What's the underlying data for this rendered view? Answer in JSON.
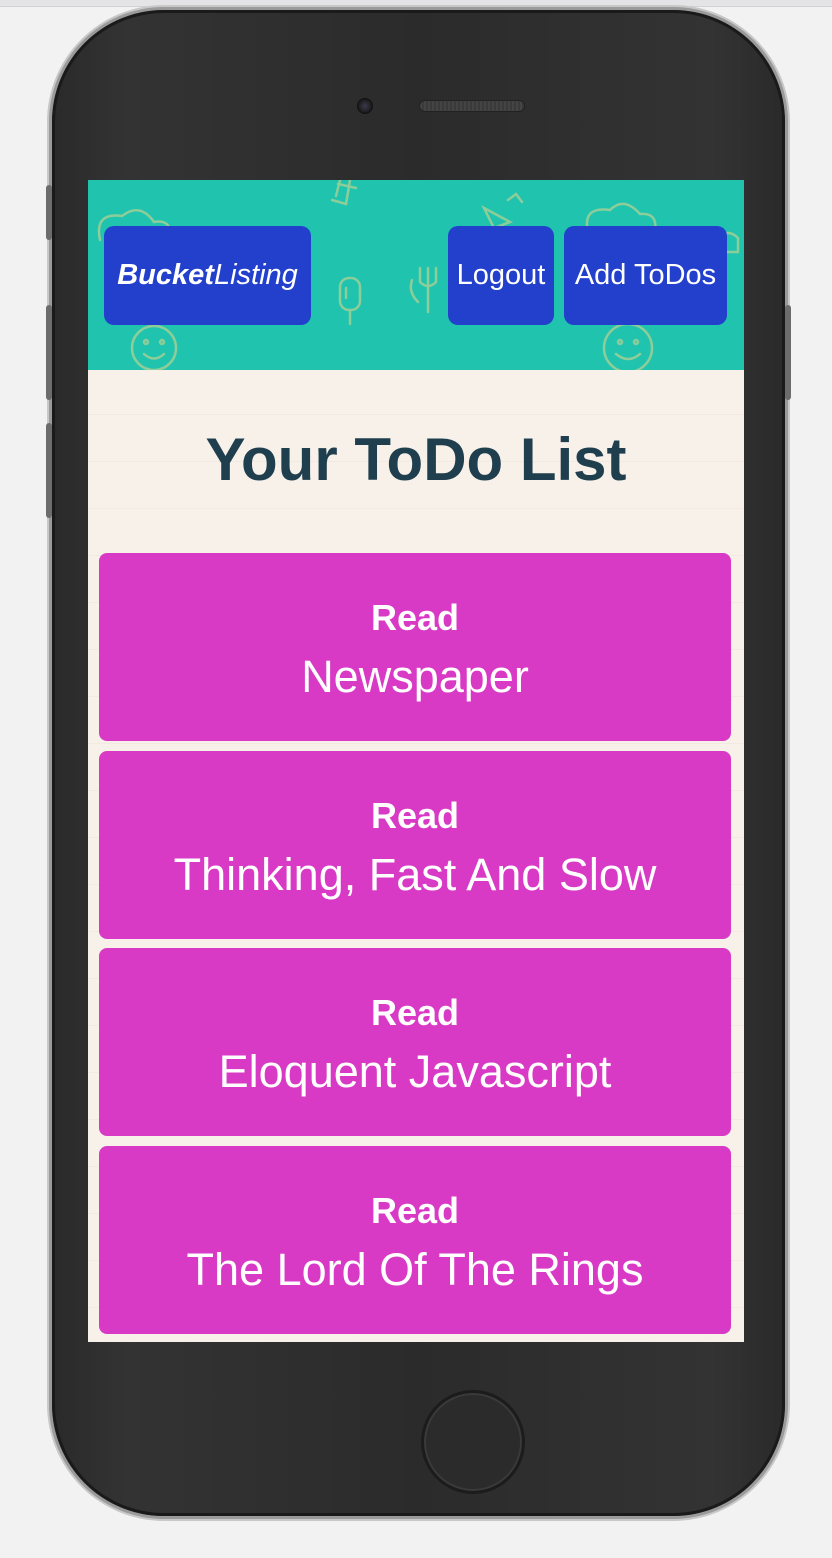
{
  "header": {
    "brand_bold": "Bucket",
    "brand_italic": "Listing",
    "logout_label": "Logout",
    "add_label": "Add ToDos"
  },
  "main": {
    "title": "Your ToDo List",
    "todos": [
      {
        "verb": "Read",
        "item": "Newspaper"
      },
      {
        "verb": "Read",
        "item": "Thinking, Fast And Slow"
      },
      {
        "verb": "Read",
        "item": "Eloquent Javascript"
      },
      {
        "verb": "Read",
        "item": "The Lord Of The Rings"
      }
    ]
  },
  "colors": {
    "header_bg": "#1fc3ae",
    "button_bg": "#2340cc",
    "card_bg": "#d93ac5",
    "title_text": "#203f4e",
    "page_bg": "#f8f1ea"
  },
  "icons": [
    "food-doodle-pattern",
    "smiley-doodle-icon",
    "fork-doodle-icon",
    "popsicle-doodle-icon"
  ]
}
